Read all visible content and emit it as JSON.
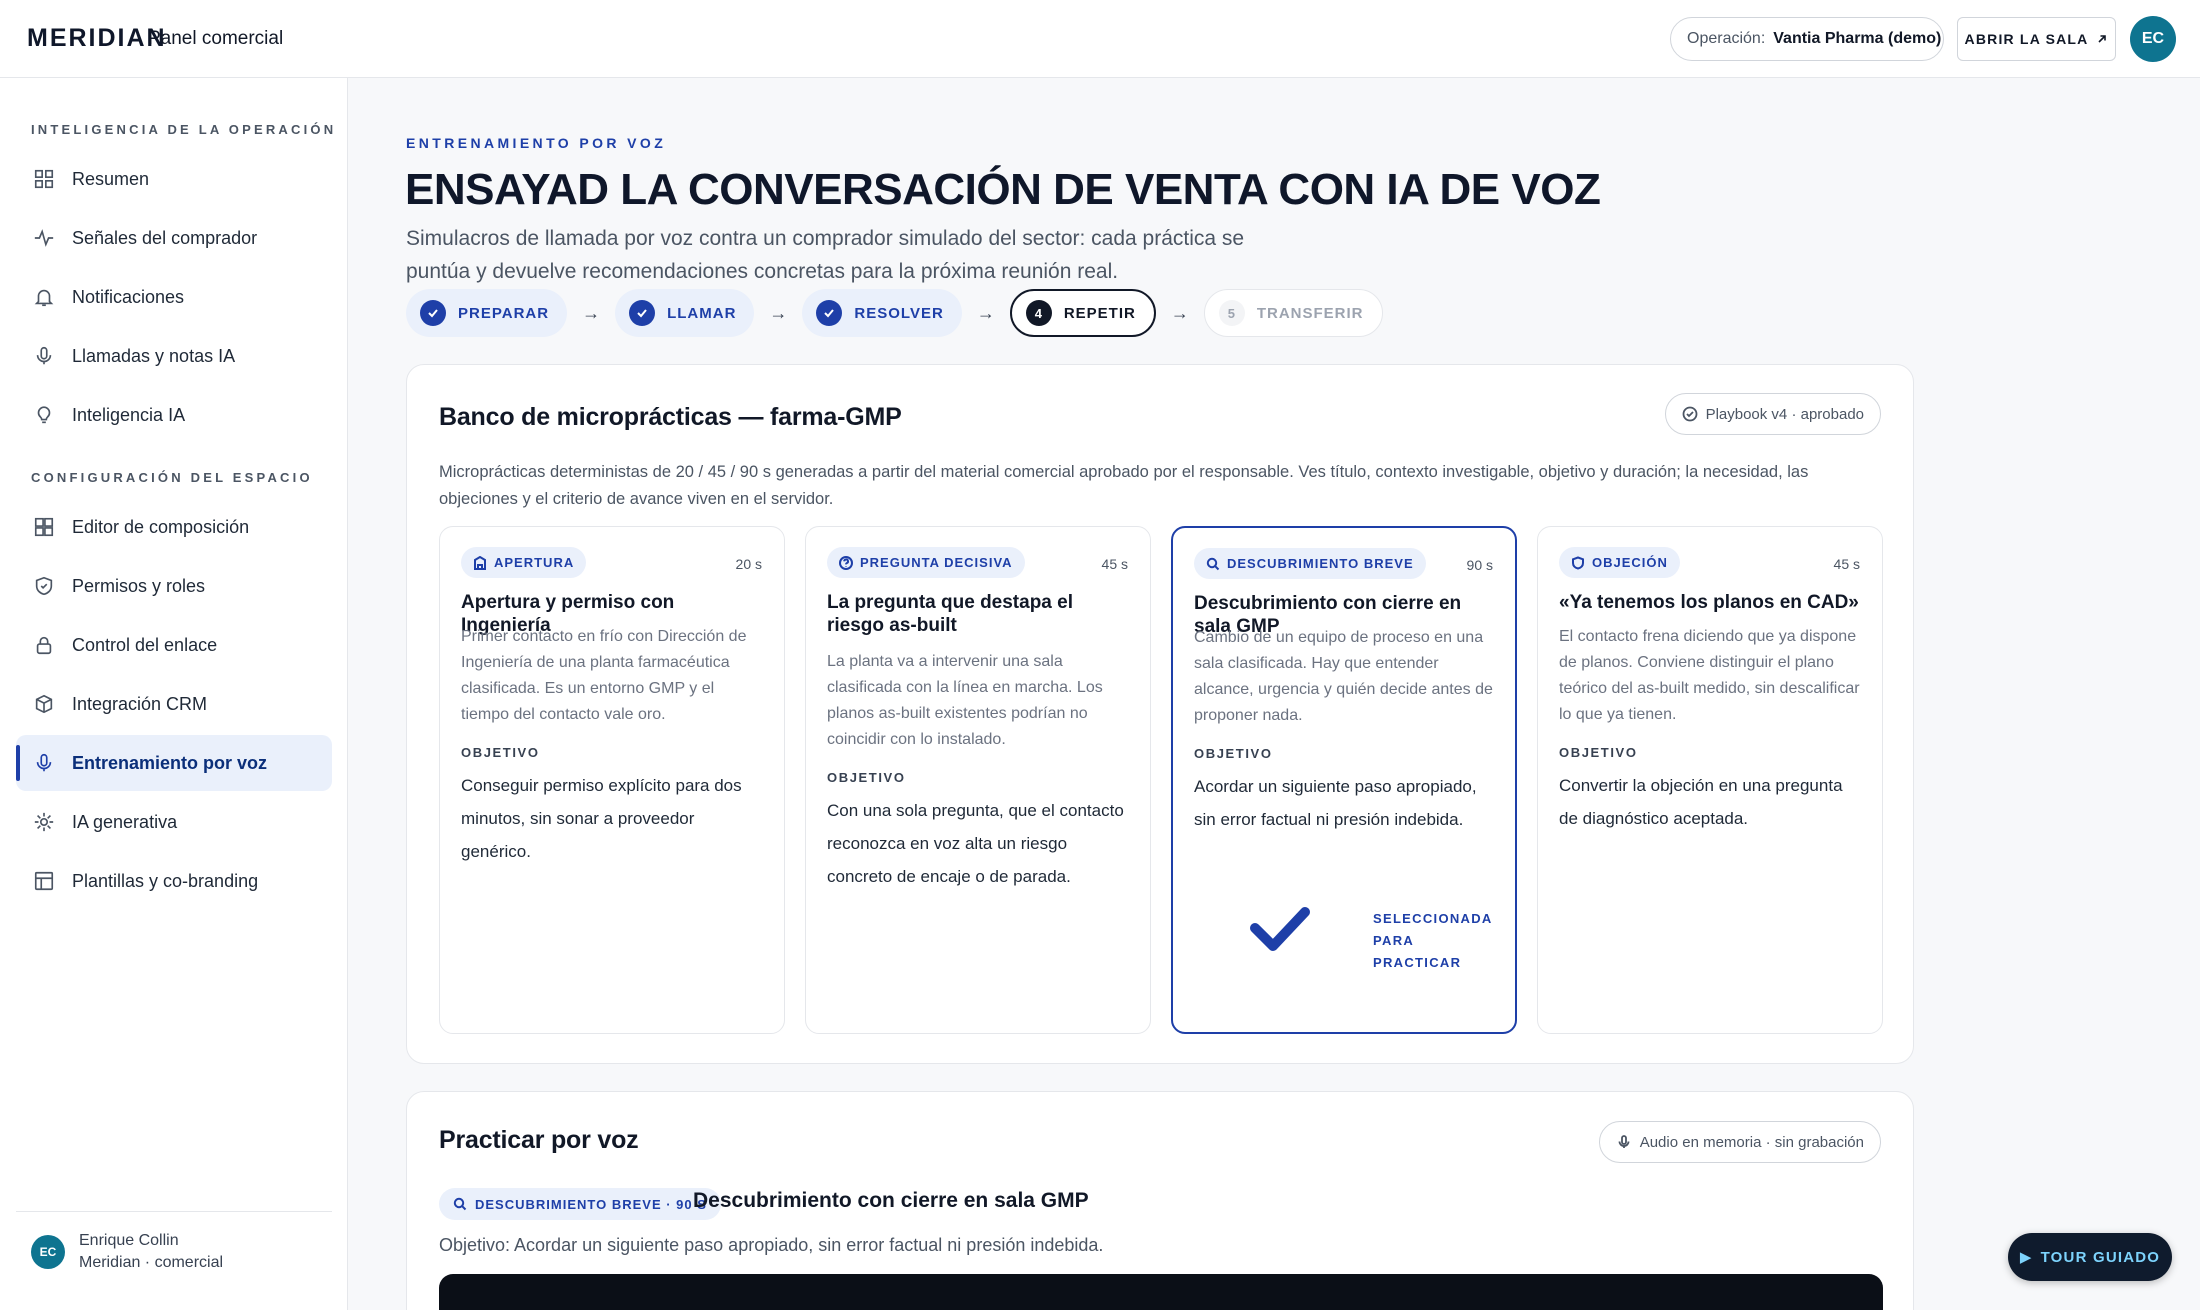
{
  "header": {
    "brand": "MERIDIAN",
    "subtitle": "Panel comercial",
    "operation_label": "Operación:",
    "operation_value": "Vantia Pharma (demo)",
    "open_room_label": "ABRIR LA SALA",
    "avatar_initials": "EC"
  },
  "sidebar": {
    "section1": "INTELIGENCIA DE LA OPERACIÓN",
    "items1": [
      {
        "label": "Resumen",
        "icon": "grid-icon"
      },
      {
        "label": "Señales del comprador",
        "icon": "pulse-icon"
      },
      {
        "label": "Notificaciones",
        "icon": "bell-icon"
      },
      {
        "label": "Llamadas y notas IA",
        "icon": "microphone-icon"
      },
      {
        "label": "Inteligencia IA",
        "icon": "lightbulb-icon"
      }
    ],
    "section2": "CONFIGURACIÓN DEL ESPACIO",
    "items2": [
      {
        "label": "Editor de composición",
        "icon": "layout-icon"
      },
      {
        "label": "Permisos y roles",
        "icon": "shield-icon"
      },
      {
        "label": "Control del enlace",
        "icon": "lock-icon"
      },
      {
        "label": "Integración CRM",
        "icon": "cube-icon"
      },
      {
        "label": "Entrenamiento por voz",
        "icon": "microphone-icon",
        "active": true
      },
      {
        "label": "IA generativa",
        "icon": "sparkle-icon"
      },
      {
        "label": "Plantillas y co-branding",
        "icon": "template-icon"
      }
    ],
    "user": {
      "initials": "EC",
      "name": "Enrique Collin",
      "role": "Meridian · comercial"
    }
  },
  "main": {
    "eyebrow": "ENTRENAMIENTO POR VOZ",
    "title": "ENSAYAD LA CONVERSACIÓN DE VENTA CON IA DE VOZ",
    "lede": "Simulacros de llamada por voz contra un comprador simulado del sector: cada práctica se puntúa y devuelve recomendaciones concretas para la próxima reunión real.",
    "steps": [
      {
        "label": "PREPARAR",
        "state": "done"
      },
      {
        "label": "LLAMAR",
        "state": "done"
      },
      {
        "label": "RESOLVER",
        "state": "done"
      },
      {
        "label": "REPETIR",
        "state": "current",
        "number": "4"
      },
      {
        "label": "TRANSFERIR",
        "state": "todo",
        "number": "5"
      }
    ]
  },
  "bank": {
    "title": "Banco de microprácticas — farma-GMP",
    "chip": "Playbook v4 · aprobado",
    "desc": "Microprácticas deterministas de 20 / 45 / 90 s generadas a partir del material comercial aprobado por el responsable. Ves título, contexto investigable, objetivo y duración; la necesidad, las objeciones y el criterio de avance viven en el servidor.",
    "objective_label": "OBJETIVO",
    "cards": [
      {
        "tag": "APERTURA",
        "icon": "building-icon",
        "duration": "20 s",
        "title": "Apertura y permiso con Ingeniería",
        "context": "Primer contacto en frío con Dirección de Ingeniería de una planta farmacéutica clasificada. Es un entorno GMP y el tiempo del contacto vale oro.",
        "objective": "Conseguir permiso explícito para dos minutos, sin sonar a proveedor genérico."
      },
      {
        "tag": "PREGUNTA DECISIVA",
        "icon": "question-icon",
        "duration": "45 s",
        "title": "La pregunta que destapa el riesgo as-built",
        "context": "La planta va a intervenir una sala clasificada con la línea en marcha. Los planos as-built existentes podrían no coincidir con lo instalado.",
        "objective": "Con una sola pregunta, que el contacto reconozca en voz alta un riesgo concreto de encaje o de parada."
      },
      {
        "tag": "DESCUBRIMIENTO BREVE",
        "icon": "search-icon",
        "duration": "90 s",
        "title": "Descubrimiento con cierre en sala GMP",
        "context": "Cambio de un equipo de proceso en una sala clasificada. Hay que entender alcance, urgencia y quién decide antes de proponer nada.",
        "objective": "Acordar un siguiente paso apropiado, sin error factual ni presión indebida.",
        "selected": true,
        "selected_line1": "SELECCIONADA",
        "selected_line2": "PARA PRACTICAR"
      },
      {
        "tag": "OBJECIÓN",
        "icon": "shield-icon",
        "duration": "45 s",
        "title": "«Ya tenemos los planos en CAD»",
        "context": "El contacto frena diciendo que ya dispone de planos. Conviene distinguir el plano teórico del as-built medido, sin descalificar lo que ya tienen.",
        "objective": "Convertir la objeción en una pregunta de diagnóstico aceptada."
      }
    ]
  },
  "practice": {
    "title": "Practicar por voz",
    "chip": "Audio en memoria · sin grabación",
    "topic_tag": "DESCUBRIMIENTO BREVE · 90 S",
    "topic_title": "Descubrimiento con cierre en sala GMP",
    "goal": "Objetivo: Acordar un siguiente paso apropiado, sin error factual ni presión indebida."
  },
  "tour_label": "TOUR GUIADO"
}
